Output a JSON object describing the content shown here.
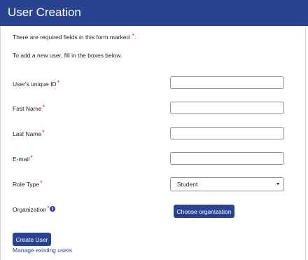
{
  "header": {
    "title": "User Creation"
  },
  "notes": {
    "required_text": "There are required fields in this form marked",
    "required_marker": "*",
    "required_period": ".",
    "instructions": "To add a new user, fill in the boxes below."
  },
  "fields": {
    "unique_id": {
      "label": "User's unique ID",
      "value": ""
    },
    "first_name": {
      "label": "First Name",
      "value": ""
    },
    "last_name": {
      "label": "Last Name",
      "value": ""
    },
    "email": {
      "label": "E-mail",
      "value": ""
    },
    "role_type": {
      "label": "Role Type",
      "selected": "Student"
    },
    "organization": {
      "label": "Organization"
    }
  },
  "required_marker": "*",
  "buttons": {
    "choose_organization": "Choose organization",
    "create_user": "Create User"
  },
  "links": {
    "manage_users": "Manage existing users"
  },
  "icons": {
    "info": "info-icon"
  },
  "colors": {
    "brand": "#2a4390",
    "required": "#c62828"
  }
}
